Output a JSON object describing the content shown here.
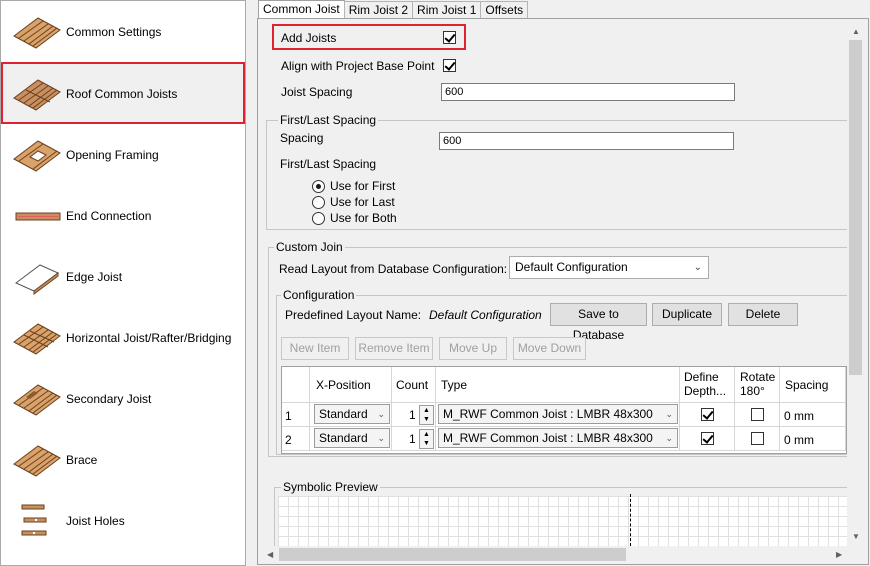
{
  "sidebar": {
    "items": [
      {
        "label": "Common Settings",
        "icon": "joist-deck-icon"
      },
      {
        "label": "Roof Common Joists",
        "icon": "roof-joists-icon"
      },
      {
        "label": "Opening Framing",
        "icon": "opening-framing-icon"
      },
      {
        "label": "End Connection",
        "icon": "end-connection-icon"
      },
      {
        "label": "Edge Joist",
        "icon": "edge-joist-icon"
      },
      {
        "label": "Horizontal Joist/Rafter/Bridging",
        "icon": "bridging-icon"
      },
      {
        "label": "Secondary Joist",
        "icon": "secondary-joist-icon"
      },
      {
        "label": "Brace",
        "icon": "brace-icon"
      },
      {
        "label": "Joist Holes",
        "icon": "joist-holes-icon"
      }
    ],
    "selected_index": 1
  },
  "tabs": [
    "Common Joist",
    "Rim Joist 2",
    "Rim Joist 1",
    "Offsets"
  ],
  "active_tab": 0,
  "form": {
    "add_joists_label": "Add Joists",
    "add_joists_checked": true,
    "align_label": "Align with Project Base Point",
    "align_checked": true,
    "joist_spacing_label": "Joist Spacing",
    "joist_spacing_value": "600"
  },
  "first_last": {
    "group_title": "First/Last Spacing",
    "spacing_label": "Spacing",
    "spacing_value": "600",
    "sub_label": "First/Last Spacing",
    "options": [
      "Use for First",
      "Use for Last",
      "Use for Both"
    ],
    "selected": 0
  },
  "custom_join": {
    "group_title": "Custom Join",
    "read_layout_label": "Read Layout from Database Configuration:",
    "read_layout_value": "Default Configuration"
  },
  "configuration": {
    "group_title": "Configuration",
    "predefined_label": "Predefined Layout Name:",
    "predefined_value": "Default Configuration",
    "save_label": "Save to Database",
    "duplicate_label": "Duplicate",
    "delete_label": "Delete",
    "new_item_label": "New Item",
    "remove_item_label": "Remove Item",
    "move_up_label": "Move Up",
    "move_down_label": "Move Down"
  },
  "table": {
    "headers": {
      "x_position": "X-Position",
      "count": "Count",
      "type": "Type",
      "define_depth": "Define Depth...",
      "rotate": "Rotate 180°",
      "spacing": "Spacing"
    },
    "rows": [
      {
        "num": "1",
        "x_position": "Standard",
        "count": "1",
        "type": "M_RWF Common Joist : LMBR 48x300",
        "define_depth": true,
        "rotate": false,
        "spacing": "0 mm"
      },
      {
        "num": "2",
        "x_position": "Standard",
        "count": "1",
        "type": "M_RWF Common Joist : LMBR 48x300",
        "define_depth": true,
        "rotate": false,
        "spacing": "0 mm"
      }
    ]
  },
  "preview": {
    "group_title": "Symbolic Preview"
  },
  "colors": {
    "highlight": "#e02230",
    "wood": "#a0683a"
  }
}
